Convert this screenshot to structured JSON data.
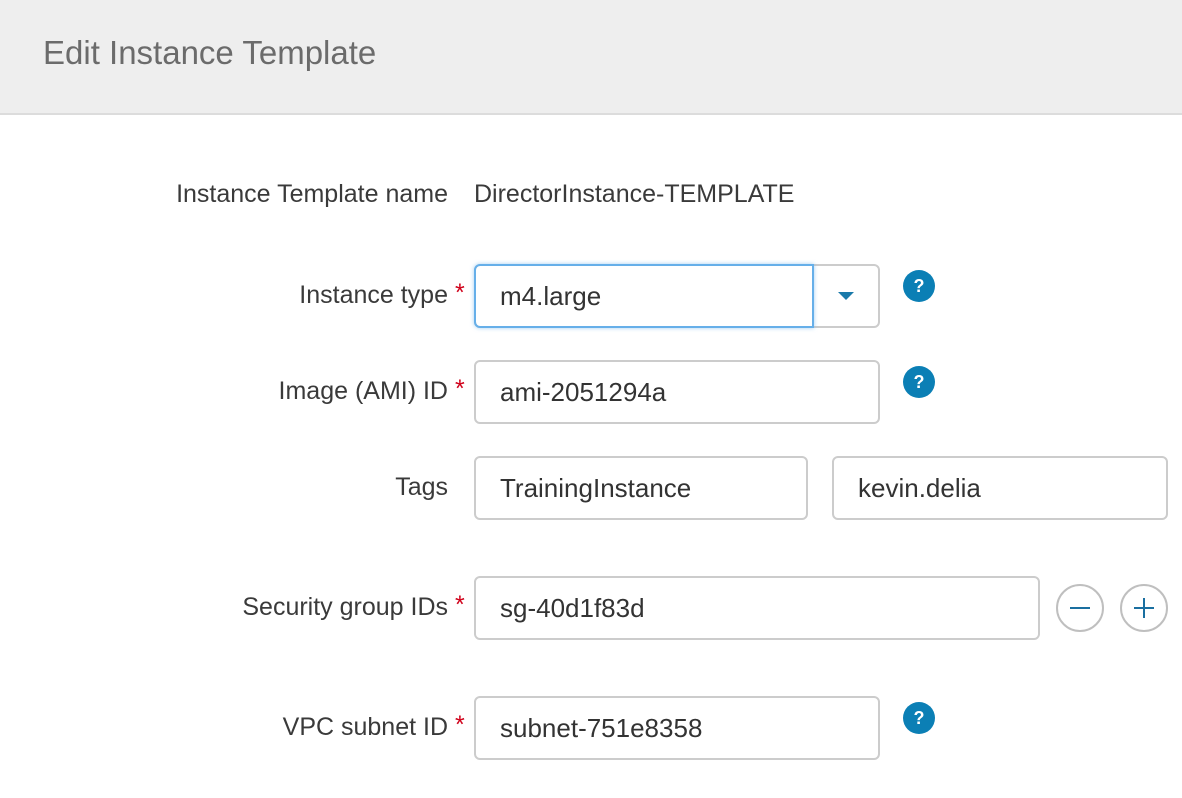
{
  "header": {
    "title": "Edit Instance Template"
  },
  "form": {
    "template_name": {
      "label": "Instance Template name",
      "value": "DirectorInstance-TEMPLATE"
    },
    "instance_type": {
      "label": "Instance type",
      "required_mark": "*",
      "value": "m4.large",
      "help": "?"
    },
    "image_id": {
      "label": "Image (AMI) ID",
      "required_mark": "*",
      "value": "ami-2051294a",
      "help": "?"
    },
    "tags": {
      "label": "Tags",
      "key": "TrainingInstance",
      "value": "kevin.delia"
    },
    "security_groups": {
      "label": "Security group IDs",
      "required_mark": "*",
      "value": "sg-40d1f83d"
    },
    "subnet": {
      "label": "VPC subnet ID",
      "required_mark": "*",
      "value": "subnet-751e8358",
      "help": "?"
    }
  },
  "icons": {
    "caret": "chevron-down-icon",
    "help": "question-circle-icon",
    "remove": "minus-circle-icon",
    "add": "plus-circle-icon"
  },
  "colors": {
    "accent": "#0b7fb5",
    "required": "#d0021b",
    "focus_border": "#66afe9",
    "header_bg": "#eeeeee"
  }
}
